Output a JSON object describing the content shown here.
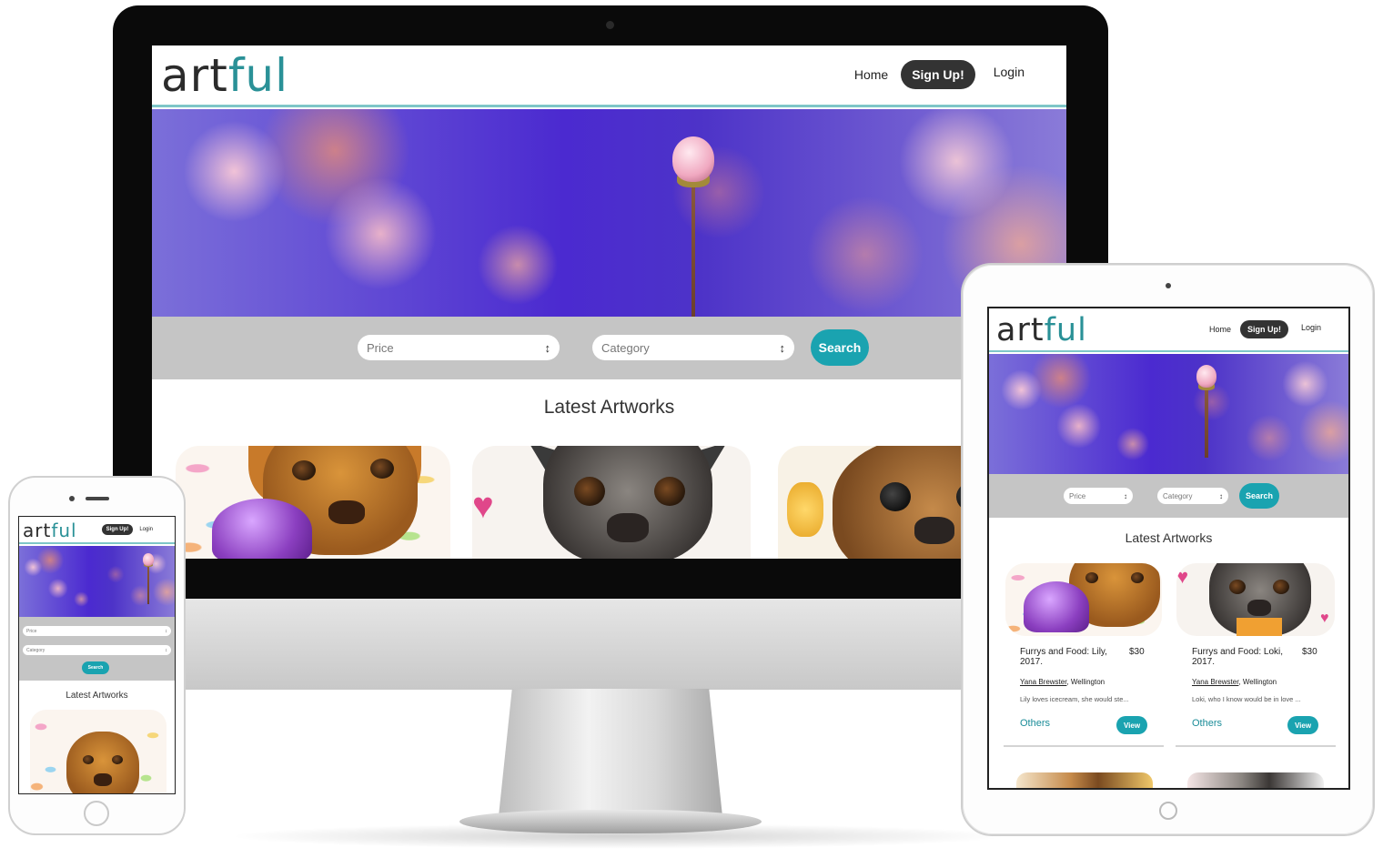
{
  "brand": {
    "logo_part1": "art",
    "logo_part2": "ful",
    "accent": "#1aa3b0",
    "nav_border": "#7ec6c8"
  },
  "nav": {
    "home": "Home",
    "signup": "Sign Up!",
    "login": "Login"
  },
  "filters": {
    "price_placeholder": "Price",
    "category_placeholder": "Category",
    "search_label": "Search"
  },
  "section": {
    "title": "Latest Artworks"
  },
  "artworks": [
    {
      "title": "Furrys and Food: Lily, 2017.",
      "price": "$30",
      "artist": "Yana Brewster",
      "location": ", Wellington",
      "description": "Lily loves icecream, she would ste...",
      "others": "Others",
      "view": "View"
    },
    {
      "title": "Furrys and Food: Loki, 2017.",
      "price": "$30",
      "artist": "Yana Brewster",
      "location": ", Wellington",
      "description": "Loki, who I know would be in love ...",
      "others": "Others",
      "view": "View"
    }
  ],
  "icons": {
    "select_arrow": "updown-arrow-icon"
  }
}
